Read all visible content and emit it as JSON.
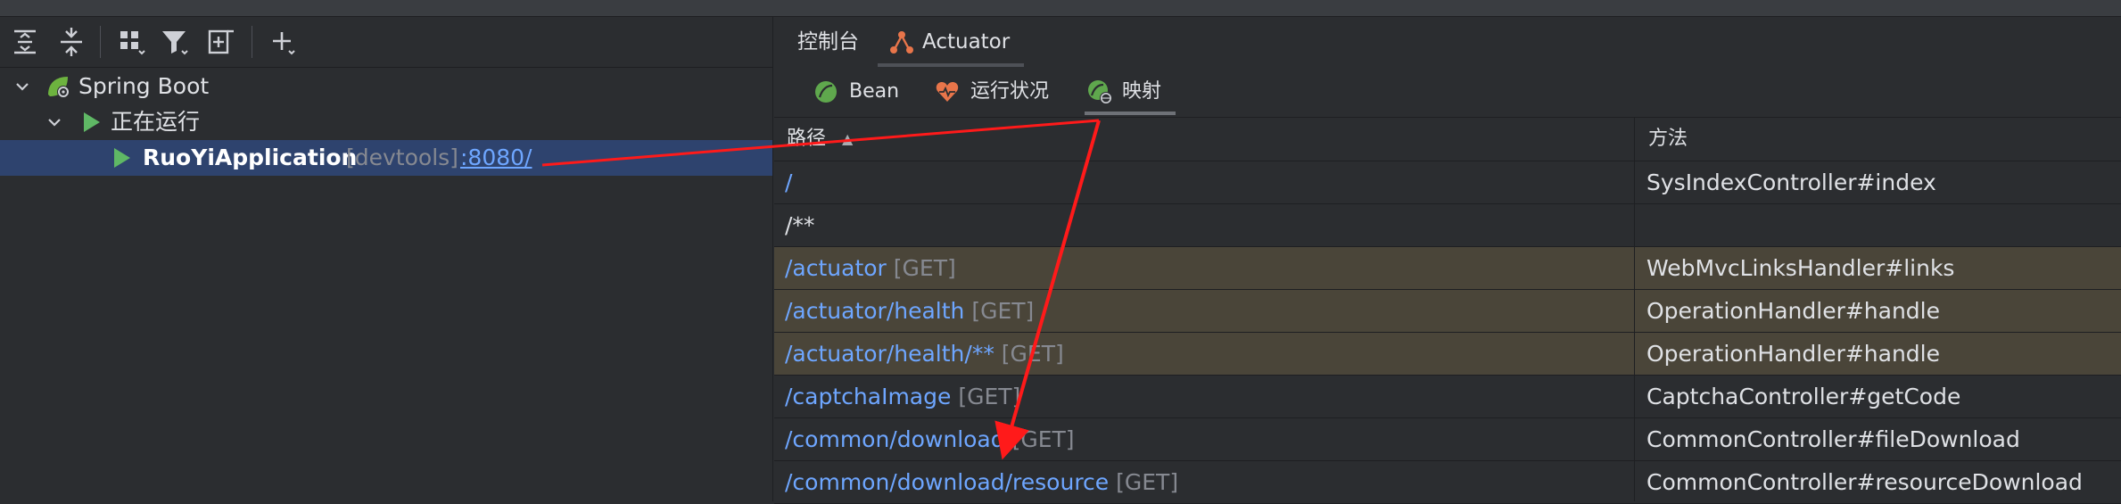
{
  "toolbar": {
    "icons": [
      "expand-all-icon",
      "collapse-all-icon",
      "group-icon",
      "filter-icon",
      "add-configuration-icon",
      "add-icon"
    ]
  },
  "tree": {
    "spring_boot": "Spring Boot",
    "running": "正在运行",
    "app_name": "RuoYiApplication",
    "app_tag": "[devtools]",
    "app_port": ":8080/"
  },
  "tabs": {
    "console": "控制台",
    "actuator": "Actuator"
  },
  "subtabs": {
    "bean": "Bean",
    "health": "运行状况",
    "mappings": "映射"
  },
  "table": {
    "headers": {
      "path": "路径",
      "method": "方法"
    },
    "rows": [
      {
        "path": "/",
        "verb": "",
        "handler": "SysIndexController#index",
        "highlight": false,
        "plain": false
      },
      {
        "path": "/**",
        "verb": "",
        "handler": "",
        "highlight": false,
        "plain": true
      },
      {
        "path": "/actuator",
        "verb": "[GET]",
        "handler": "WebMvcLinksHandler#links",
        "highlight": true,
        "plain": false
      },
      {
        "path": "/actuator/health",
        "verb": "[GET]",
        "handler": "OperationHandler#handle",
        "highlight": true,
        "plain": false
      },
      {
        "path": "/actuator/health/**",
        "verb": "[GET]",
        "handler": "OperationHandler#handle",
        "highlight": true,
        "plain": false
      },
      {
        "path": "/captchaImage",
        "verb": "[GET]",
        "handler": "CaptchaController#getCode",
        "highlight": false,
        "plain": false
      },
      {
        "path": "/common/download",
        "verb": "[GET]",
        "handler": "CommonController#fileDownload",
        "highlight": false,
        "plain": false
      },
      {
        "path": "/common/download/resource",
        "verb": "[GET]",
        "handler": "CommonController#resourceDownload",
        "highlight": false,
        "plain": false
      }
    ]
  },
  "colors": {
    "background": "#2b2d30",
    "selection": "#2e436e",
    "highlight_row": "#4a4539",
    "link": "#6ea6ff",
    "run_green": "#5fb865",
    "annotation_red": "#ff1a1a"
  }
}
